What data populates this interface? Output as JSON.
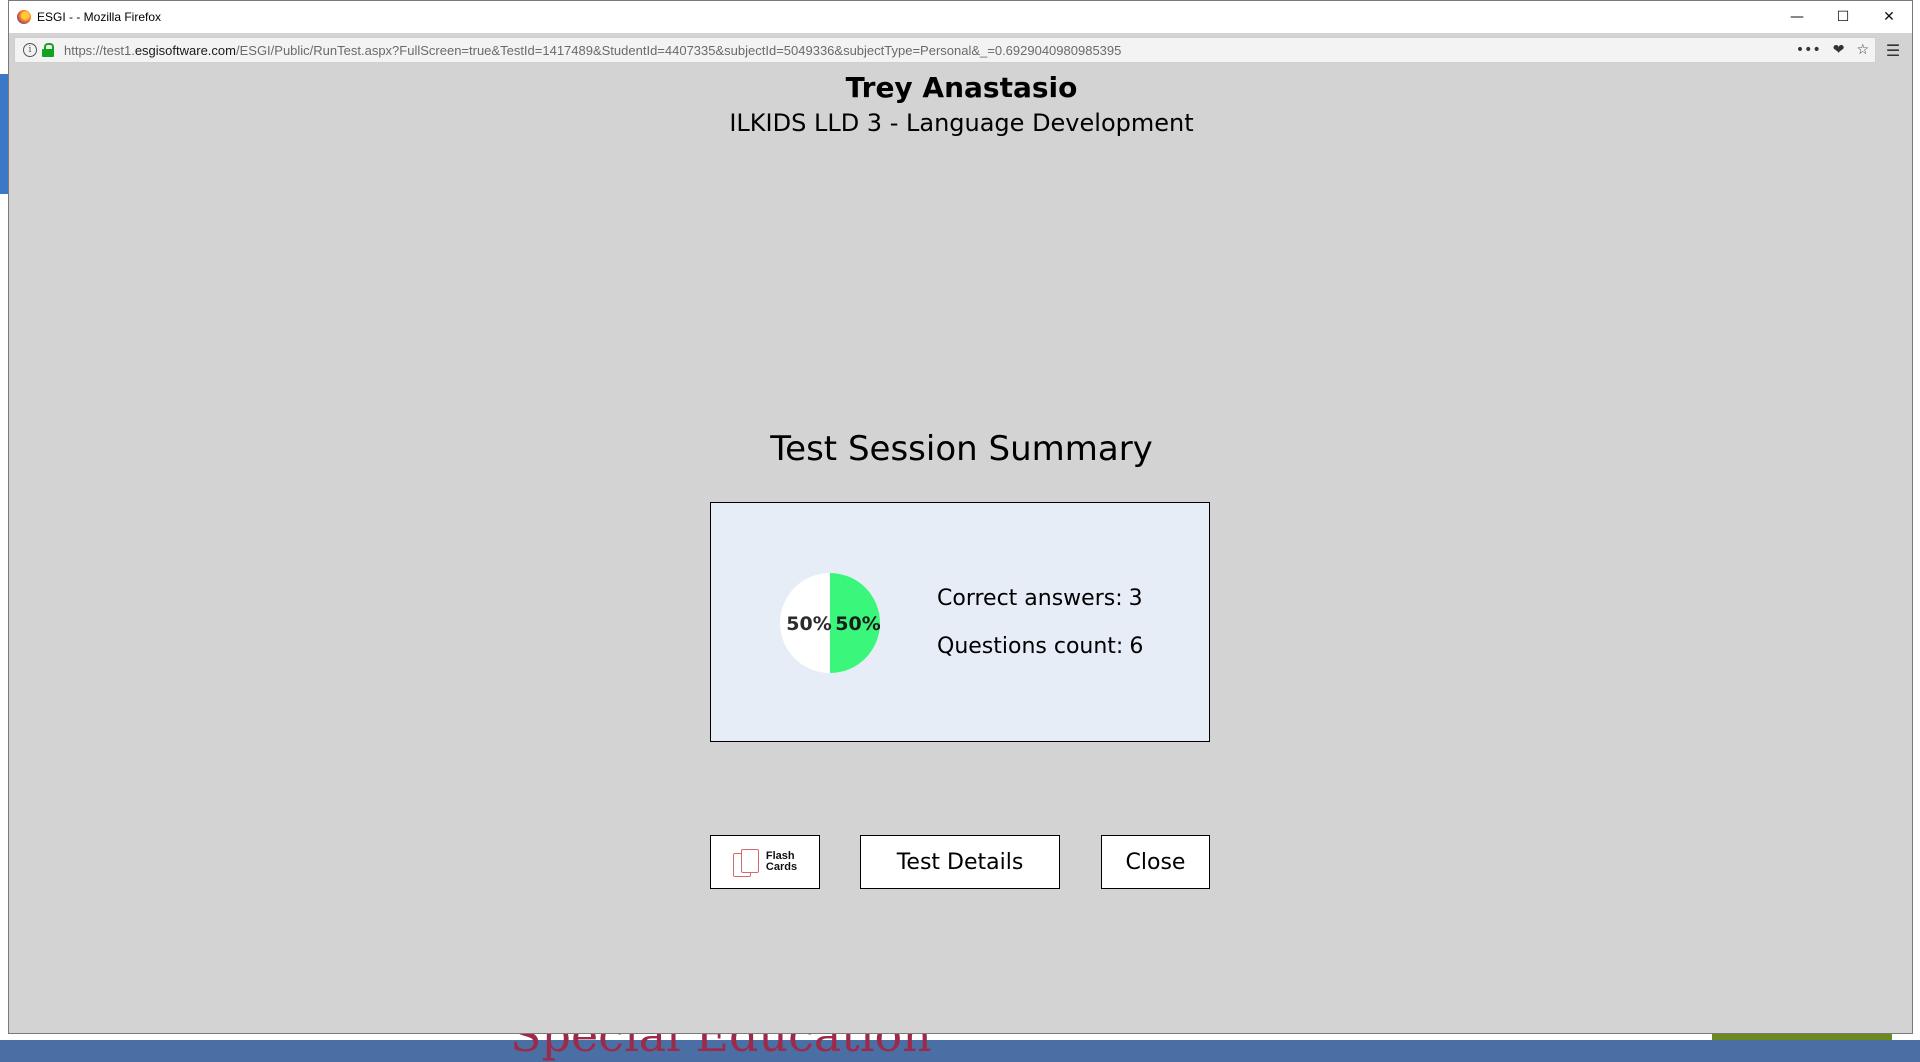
{
  "window": {
    "title": "ESGI - - Mozilla Firefox",
    "controls": {
      "minimize": "—",
      "maximize": "☐",
      "close": "✕"
    }
  },
  "urlbar": {
    "url_prefix": "https://test1.",
    "url_host": "esgisoftware.com",
    "url_rest": "/ESGI/Public/RunTest.aspx?FullScreen=true&TestId=1417489&StudentId=4407335&subjectId=5049336&subjectType=Personal&_=0.6929040980985395",
    "actions": {
      "more": "•••",
      "pocket": "❤",
      "bookmark": "☆"
    },
    "menu": "☰"
  },
  "header": {
    "student_name": "Trey Anastasio",
    "subject": "ILKIDS LLD 3 - Language Development"
  },
  "summary": {
    "title": "Test Session Summary",
    "correct_label": "Correct answers:",
    "correct_value": "3",
    "questions_label": "Questions count:",
    "questions_value": "6",
    "pie": {
      "incorrect_label": "50%",
      "correct_label": "50%",
      "correct_fraction": 0.5,
      "colors": {
        "correct": "#3af67a",
        "incorrect": "#ffffff"
      }
    }
  },
  "buttons": {
    "flash_line1": "Flash",
    "flash_line2": "Cards",
    "details": "Test Details",
    "close": "Close"
  },
  "background": {
    "heading_fragment": "Special Education"
  }
}
